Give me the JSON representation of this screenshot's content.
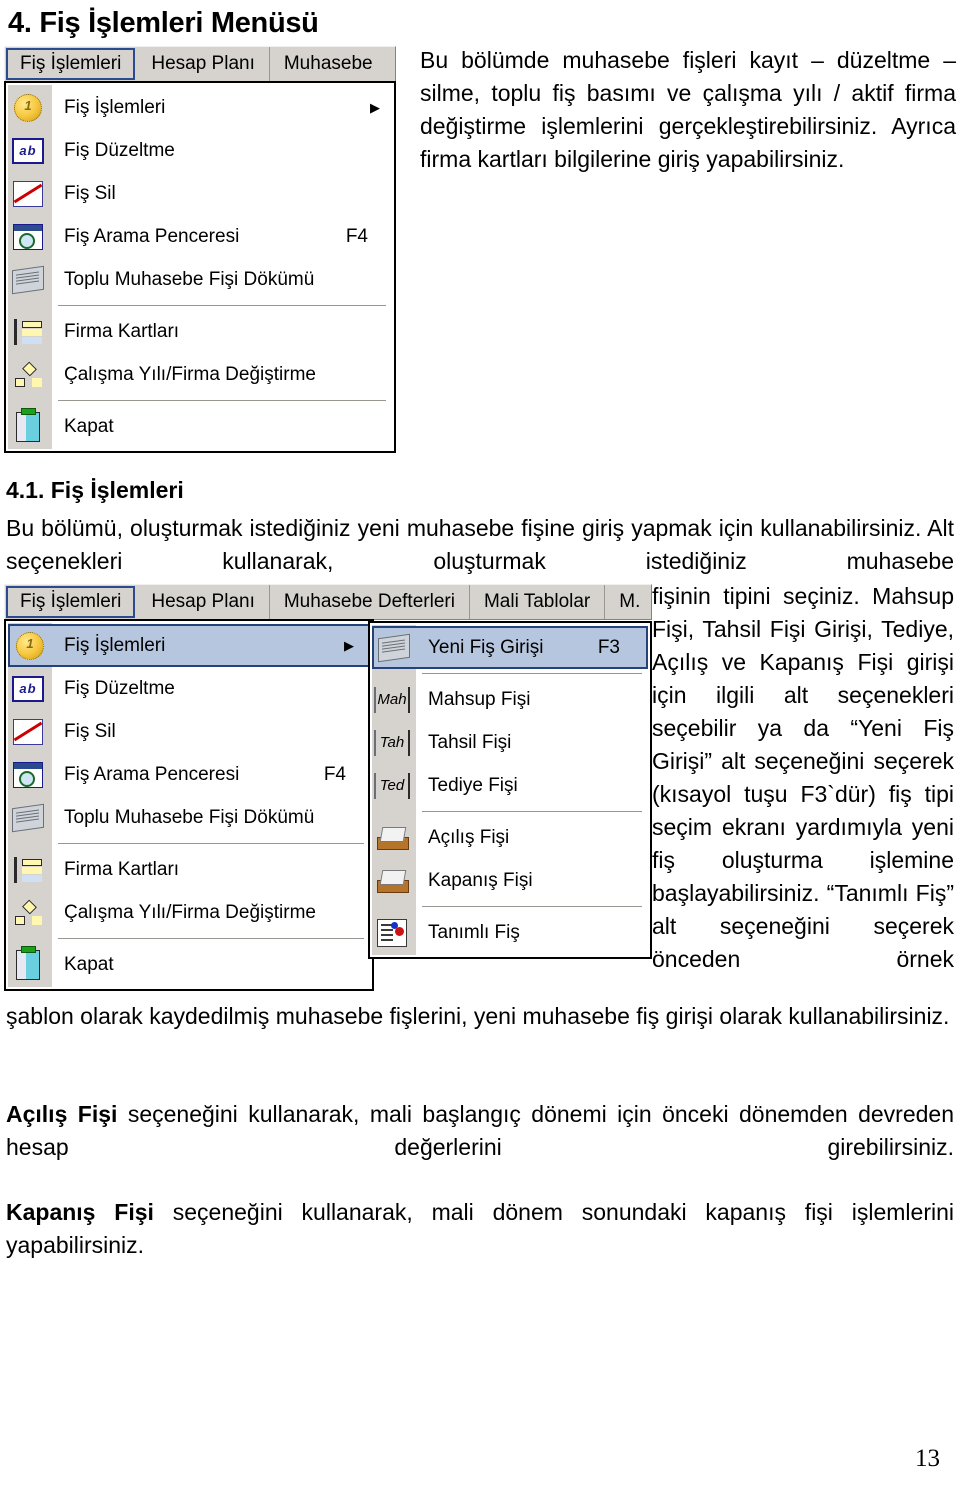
{
  "document": {
    "heading1": "4. Fiş İşlemleri Menüsü",
    "heading2": "4.1. Fiş İşlemleri",
    "intro_paragraph": "Bu bölümde muhasebe fişleri kayıt – düzeltme – silme, toplu fiş basımı ve çalışma yılı / aktif firma değiştirme işlemlerini gerçekleştirebilirsiniz. Ayrıca firma kartları bilgilerine giriş yapabilirsiniz.",
    "section_paragraph_lead": "Bu bölümü, oluşturmak istediğiniz yeni muhasebe fişine giriş yapmak için kullanabilirsiniz. Alt seçenekleri kullanarak, oluşturmak istediğiniz muhasebe",
    "section_paragraph_side": "fişinin tipini seçiniz. Mahsup Fişi, Tahsil Fişi Girişi, Tediye, Açılış ve Kapanış Fişi girişi için ilgili alt seçenekleri seçebilir ya da “Yeni Fiş Girişi” alt seçeneğini seçerek (kısayol tuşu F3`dür) fiş tipi seçim ekranı yardımıyla yeni fiş oluşturma işlemine başlayabilirsiniz. “Tanımlı Fiş” alt seçeneğini seçerek önceden örnek",
    "section_paragraph_tail": "şablon olarak kaydedilmiş muhasebe fişlerini, yeni muhasebe fiş girişi olarak kullanabilirsiniz.",
    "para_acilis_bold": "Açılış Fişi",
    "para_acilis_rest": " seçeneğini kullanarak, mali başlangıç dönemi için önceki dönemden devreden hesap değerlerini girebilirsiniz.",
    "para_kapanis_bold": "Kapanış Fişi",
    "para_kapanis_rest": " seçeneğini kullanarak, mali dönem sonundaki kapanış fişi işlemlerini yapabilirsiniz.",
    "page_number": "13"
  },
  "colors": {
    "menu_face": "#d6d3ce",
    "highlight_fill": "#b6c6de",
    "highlight_border": "#26427a",
    "menu_border": "#000000",
    "separator": "#9a9792"
  },
  "screenshot_top": {
    "menubar": [
      {
        "label": "Fiş İşlemleri",
        "active": true
      },
      {
        "label": "Hesap Planı",
        "active": false
      },
      {
        "label": "Muhasebe",
        "active": false
      }
    ],
    "dropdown": [
      {
        "label": "Fiş İşlemleri",
        "accel": "",
        "arrow": "▶",
        "icon": "coin-icon"
      },
      {
        "label": "Fiş Düzeltme",
        "accel": "",
        "arrow": "",
        "icon": "ab-text-edit-icon"
      },
      {
        "label": "Fiş Sil",
        "accel": "",
        "arrow": "",
        "icon": "delete-strike-icon"
      },
      {
        "label": "Fiş Arama Penceresi",
        "accel": "F4",
        "arrow": "",
        "icon": "search-window-icon"
      },
      {
        "label": "Toplu Muhasebe Fişi Dökümü",
        "accel": "",
        "arrow": "",
        "icon": "printout-icon"
      },
      {
        "label": "Firma Kartları",
        "accel": "",
        "arrow": "",
        "icon": "cards-icon"
      },
      {
        "label": "Çalışma Yılı/Firma Değiştirme",
        "accel": "",
        "arrow": "",
        "icon": "org-tree-icon"
      },
      {
        "label": "Kapat",
        "accel": "",
        "arrow": "",
        "icon": "exit-door-icon"
      }
    ]
  },
  "screenshot_bottom": {
    "menubar": [
      {
        "label": "Fiş İşlemleri",
        "active": true
      },
      {
        "label": "Hesap Planı",
        "active": false
      },
      {
        "label": "Muhasebe Defterleri",
        "active": false
      },
      {
        "label": "Mali Tablolar",
        "active": false
      },
      {
        "label": "M.",
        "active": false
      }
    ],
    "dropdown": [
      {
        "label": "Fiş İşlemleri",
        "accel": "",
        "arrow": "▶",
        "icon": "coin-icon",
        "highlighted": true
      },
      {
        "label": "Fiş Düzeltme",
        "accel": "",
        "arrow": "",
        "icon": "ab-text-edit-icon",
        "highlighted": false
      },
      {
        "label": "Fiş Sil",
        "accel": "",
        "arrow": "",
        "icon": "delete-strike-icon",
        "highlighted": false
      },
      {
        "label": "Fiş Arama Penceresi",
        "accel": "F4",
        "arrow": "",
        "icon": "search-window-icon",
        "highlighted": false
      },
      {
        "label": "Toplu Muhasebe Fişi Dökümü",
        "accel": "",
        "arrow": "",
        "icon": "printout-icon",
        "highlighted": false
      },
      {
        "label": "Firma Kartları",
        "accel": "",
        "arrow": "",
        "icon": "cards-icon",
        "highlighted": false
      },
      {
        "label": "Çalışma Yılı/Firma Değiştirme",
        "accel": "",
        "arrow": "",
        "icon": "org-tree-icon",
        "highlighted": false
      },
      {
        "label": "Kapat",
        "accel": "",
        "arrow": "",
        "icon": "exit-door-icon",
        "highlighted": false
      }
    ],
    "submenu": [
      {
        "label": "Yeni Fiş Girişi",
        "accel": "F3",
        "icon": "printout-icon",
        "icon_text": "",
        "highlighted": true
      },
      {
        "label": "Mahsup Fişi",
        "accel": "",
        "icon": "text-tag-icon",
        "icon_text": "Mah",
        "highlighted": false
      },
      {
        "label": "Tahsil Fişi",
        "accel": "",
        "icon": "text-tag-icon",
        "icon_text": "Tah",
        "highlighted": false
      },
      {
        "label": "Tediye Fişi",
        "accel": "",
        "icon": "text-tag-icon",
        "icon_text": "Ted",
        "highlighted": false
      },
      {
        "label": "Açılış Fişi",
        "accel": "",
        "icon": "box-open-icon",
        "icon_text": "",
        "highlighted": false
      },
      {
        "label": "Kapanış Fişi",
        "accel": "",
        "icon": "box-close-icon",
        "icon_text": "",
        "highlighted": false
      },
      {
        "label": "Tanımlı Fiş",
        "accel": "",
        "icon": "template-list-icon",
        "icon_text": "",
        "highlighted": false
      }
    ]
  }
}
